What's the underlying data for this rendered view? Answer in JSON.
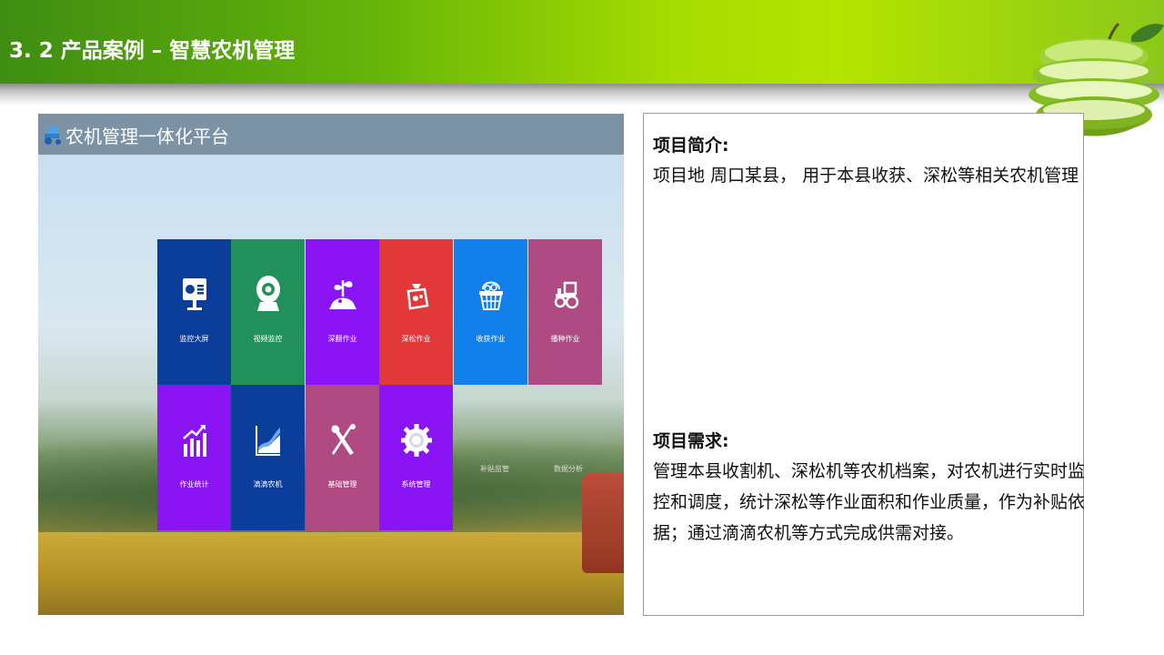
{
  "slide": {
    "title": "3. 2 产品案例 – 智慧农机管理"
  },
  "platform": {
    "title": "农机管理一体化平台"
  },
  "tiles": [
    {
      "label": "监控大屏",
      "icon": "monitor-screen-icon",
      "color": "#0a3e9a"
    },
    {
      "label": "视频监控",
      "icon": "webcam-icon",
      "color": "#22905a"
    },
    {
      "label": "深翻作业",
      "icon": "plant-sprout-icon",
      "color": "#8a14f4"
    },
    {
      "label": "深松作业",
      "icon": "seed-bag-icon",
      "color": "#e2383a"
    },
    {
      "label": "收获作业",
      "icon": "harvest-basket-icon",
      "color": "#1180ea"
    },
    {
      "label": "播种作业",
      "icon": "tractor-icon",
      "color": "#b04a82"
    },
    {
      "label": "作业统计",
      "icon": "bar-chart-icon",
      "color": "#8a14f4"
    },
    {
      "label": "滴滴农机",
      "icon": "area-chart-icon",
      "color": "#0a3e9a"
    },
    {
      "label": "基础管理",
      "icon": "tools-icon",
      "color": "#b04a82"
    },
    {
      "label": "系统管理",
      "icon": "gear-icon",
      "color": "#8a14f4"
    }
  ],
  "ghost_labels": [
    "补贴监管",
    "数据分析"
  ],
  "info": {
    "intro_title": "项目简介:",
    "intro_text": "项目地 周口某县， 用于本县收获、深松等相关农机管理",
    "req_title": "项目需求:",
    "req_text": "管理本县收割机、深松机等农机档案，对农机进行实时监控和调度，统计深松等作业面积和作业质量，作为补贴依据；通过滴滴农机等方式完成供需对接。"
  }
}
